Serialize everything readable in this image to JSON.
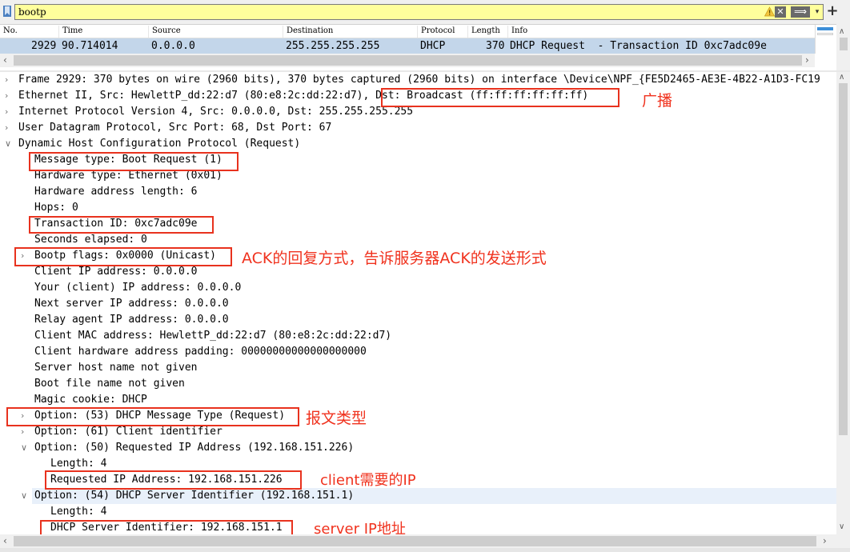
{
  "filter": {
    "value": "bootp"
  },
  "toolbar": {
    "clear_glyph": "✕",
    "apply_glyph": "⟹",
    "dropdown_glyph": "▾",
    "add_glyph": "+"
  },
  "packet_list": {
    "columns": [
      "No.",
      "Time",
      "Source",
      "Destination",
      "Protocol",
      "Length",
      "Info"
    ],
    "rows": [
      {
        "no": "2929",
        "time": "90.714014",
        "source": "0.0.0.0",
        "destination": "255.255.255.255",
        "protocol": "DHCP",
        "length": "370",
        "info": "DHCP Request  - Transaction ID 0xc7adc09e"
      }
    ]
  },
  "details": [
    {
      "text": "Frame 2929: 370 bytes on wire (2960 bits), 370 bytes captured (2960 bits) on interface \\Device\\NPF_{FE5D2465-AE3E-4B22-A1D3-FC19",
      "indent": 0,
      "toggle": "closed"
    },
    {
      "text": "Ethernet II, Src: HewlettP_dd:22:d7 (80:e8:2c:dd:22:d7), Dst: Broadcast (ff:ff:ff:ff:ff:ff)",
      "indent": 0,
      "toggle": "closed"
    },
    {
      "text": "Internet Protocol Version 4, Src: 0.0.0.0, Dst: 255.255.255.255",
      "indent": 0,
      "toggle": "closed"
    },
    {
      "text": "User Datagram Protocol, Src Port: 68, Dst Port: 67",
      "indent": 0,
      "toggle": "closed"
    },
    {
      "text": "Dynamic Host Configuration Protocol (Request)",
      "indent": 0,
      "toggle": "open"
    },
    {
      "text": "Message type: Boot Request (1)",
      "indent": 1,
      "toggle": ""
    },
    {
      "text": "Hardware type: Ethernet (0x01)",
      "indent": 1,
      "toggle": ""
    },
    {
      "text": "Hardware address length: 6",
      "indent": 1,
      "toggle": ""
    },
    {
      "text": "Hops: 0",
      "indent": 1,
      "toggle": ""
    },
    {
      "text": "Transaction ID: 0xc7adc09e",
      "indent": 1,
      "toggle": ""
    },
    {
      "text": "Seconds elapsed: 0",
      "indent": 1,
      "toggle": ""
    },
    {
      "text": "Bootp flags: 0x0000 (Unicast)",
      "indent": 1,
      "toggle": "closed"
    },
    {
      "text": "Client IP address: 0.0.0.0",
      "indent": 1,
      "toggle": ""
    },
    {
      "text": "Your (client) IP address: 0.0.0.0",
      "indent": 1,
      "toggle": ""
    },
    {
      "text": "Next server IP address: 0.0.0.0",
      "indent": 1,
      "toggle": ""
    },
    {
      "text": "Relay agent IP address: 0.0.0.0",
      "indent": 1,
      "toggle": ""
    },
    {
      "text": "Client MAC address: HewlettP_dd:22:d7 (80:e8:2c:dd:22:d7)",
      "indent": 1,
      "toggle": ""
    },
    {
      "text": "Client hardware address padding: 00000000000000000000",
      "indent": 1,
      "toggle": ""
    },
    {
      "text": "Server host name not given",
      "indent": 1,
      "toggle": ""
    },
    {
      "text": "Boot file name not given",
      "indent": 1,
      "toggle": ""
    },
    {
      "text": "Magic cookie: DHCP",
      "indent": 1,
      "toggle": ""
    },
    {
      "text": "Option: (53) DHCP Message Type (Request)",
      "indent": 1,
      "toggle": "closed"
    },
    {
      "text": "Option: (61) Client identifier",
      "indent": 1,
      "toggle": "closed"
    },
    {
      "text": "Option: (50) Requested IP Address (192.168.151.226)",
      "indent": 1,
      "toggle": "open"
    },
    {
      "text": "Length: 4",
      "indent": 2,
      "toggle": ""
    },
    {
      "text": "Requested IP Address: 192.168.151.226",
      "indent": 2,
      "toggle": ""
    },
    {
      "text": "Option: (54) DHCP Server Identifier (192.168.151.1)",
      "indent": 1,
      "toggle": "open"
    },
    {
      "text": "Length: 4",
      "indent": 2,
      "toggle": ""
    },
    {
      "text": "DHCP Server Identifier: 192.168.151.1",
      "indent": 2,
      "toggle": ""
    }
  ],
  "annotations": [
    "广播",
    "ACK的回复方式，告诉服务器ACK的发送形式",
    "报文类型",
    "client需要的IP",
    "server  IP地址"
  ],
  "colors": {
    "filter_bg": "#ffff9c",
    "selected_row": "#c3d6ea",
    "annotation_red": "#e8321e"
  }
}
